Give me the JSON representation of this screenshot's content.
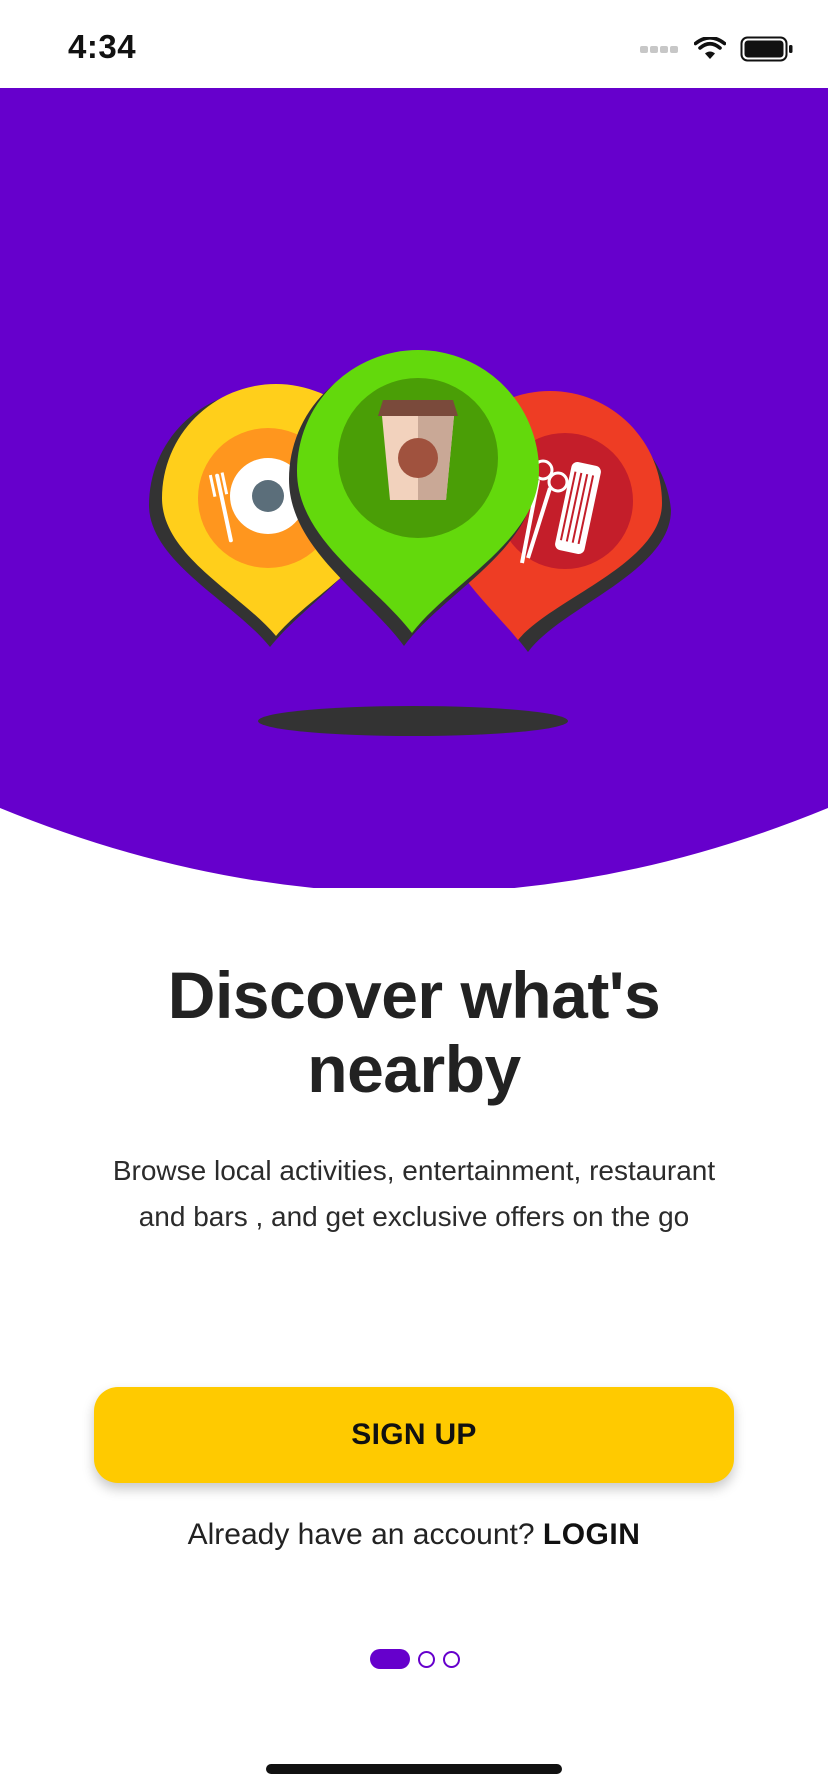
{
  "status_bar": {
    "time": "4:34"
  },
  "hero": {
    "background_color": "#6600CC",
    "pins": [
      {
        "name": "restaurant-pin",
        "color": "#FFCF1B",
        "icon": "plate-fork-icon"
      },
      {
        "name": "cafe-pin",
        "color": "#63D90C",
        "icon": "coffee-cup-icon"
      },
      {
        "name": "salon-pin",
        "color": "#EE3D24",
        "icon": "scissors-comb-icon"
      }
    ]
  },
  "onboarding": {
    "title": "Discover what's nearby",
    "description": "Browse local activities, entertainment, restaurant and bars , and get exclusive offers on the go",
    "signup_label": "SIGN UP",
    "login_prompt": "Already have an account?",
    "login_label": "LOGIN",
    "page_indicator": {
      "current": 1,
      "total": 3
    }
  },
  "colors": {
    "accent": "#6600CC",
    "button": "#FFCA00"
  }
}
